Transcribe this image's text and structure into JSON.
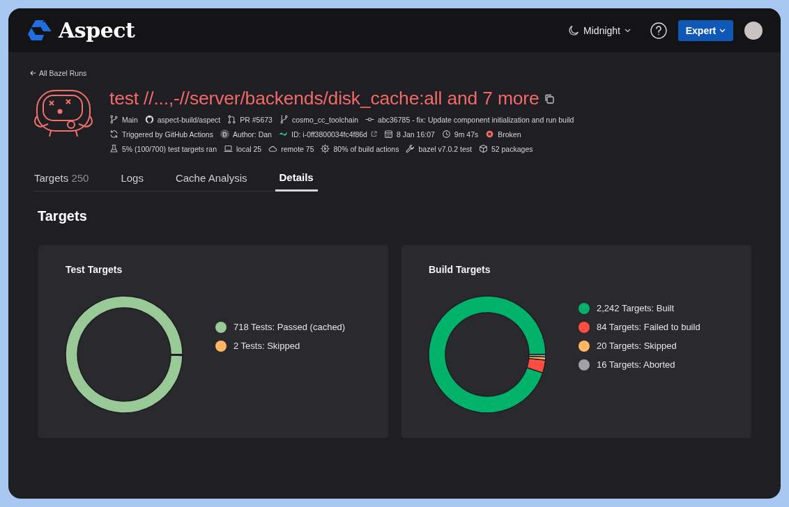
{
  "header": {
    "brand": "Aspect",
    "theme": "Midnight",
    "mode_button": "Expert"
  },
  "back_link": "All Bazel Runs",
  "run": {
    "title": "test //...,-//server/backends/disk_cache:all and 7 more",
    "meta_rows": [
      [
        {
          "text": "Main"
        },
        {
          "text": "aspect-build/aspect"
        },
        {
          "text": "PR #5673"
        },
        {
          "text": "cosmo_cc_toolchain"
        },
        {
          "text": "abc36785 - fix: Update component initialization and run build"
        }
      ],
      [
        {
          "text": "Triggered by GitHub Actions"
        },
        {
          "badge": "D",
          "text": "Author: Dan"
        },
        {
          "text": "ID: i-0ff3800034fc4f86d"
        },
        {
          "text": "8 Jan 16:07"
        },
        {
          "text": "9m 47s"
        },
        {
          "text": "Broken"
        }
      ],
      [
        {
          "text": "5% (100/700) test targets ran"
        },
        {
          "text": "local 25"
        },
        {
          "text": "remote 75"
        },
        {
          "text": "80% of build actions"
        },
        {
          "text": "bazel v7.0.2 test"
        },
        {
          "text": "52 packages"
        }
      ]
    ]
  },
  "tabs": [
    {
      "label": "Targets",
      "count": "250",
      "selected": false
    },
    {
      "label": "Logs",
      "selected": false
    },
    {
      "label": "Cache Analysis",
      "selected": false
    },
    {
      "label": "Details",
      "selected": true
    }
  ],
  "section_title": "Targets",
  "cards": [
    {
      "title": "Test Targets",
      "legend": [
        {
          "color": "#98c997"
        },
        {
          "color": "#ffb764"
        }
      ],
      "chart_data": {
        "type": "donut",
        "categories": [
          "718 Tests: Passed (cached)",
          "2 Tests: Skipped"
        ],
        "values": [
          718,
          2
        ]
      }
    },
    {
      "title": "Build Targets",
      "legend": [
        {
          "color": "#00b26a"
        },
        {
          "color": "#ff4d42"
        },
        {
          "color": "#ffb764"
        },
        {
          "color": "#a3a2a8"
        }
      ],
      "chart_data": {
        "type": "donut",
        "categories": [
          "2,242 Targets: Built",
          "84 Targets: Failed to build",
          "20 Targets: Skipped",
          "16 Targets: Aborted"
        ],
        "values": [
          2242,
          84,
          20,
          16
        ]
      }
    }
  ]
}
